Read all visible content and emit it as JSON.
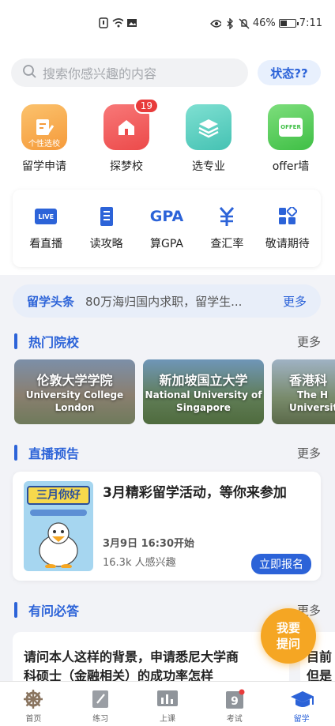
{
  "status_bar": {
    "battery": "46%",
    "battery_level": 0.46,
    "time": "7:11"
  },
  "search": {
    "placeholder": "搜索你感兴趣的内容"
  },
  "status_button": "状态??",
  "big_icons": [
    {
      "label": "留学申请",
      "tag": "个性选校",
      "color": "#f6a340"
    },
    {
      "label": "探梦校",
      "badge": "19",
      "color": "#f05a5a"
    },
    {
      "label": "选专业",
      "color": "#5ccfc0"
    },
    {
      "label": "offer墙",
      "tag": "OFFER",
      "color": "#58c95a"
    }
  ],
  "small_icons": [
    {
      "label": "看直播",
      "icon_text": "LIVE"
    },
    {
      "label": "读攻略"
    },
    {
      "label": "算GPA",
      "icon_text": "GPA"
    },
    {
      "label": "查汇率"
    },
    {
      "label": "敬请期待"
    }
  ],
  "news": {
    "tag": "留学头条",
    "text": "80万海归国内求职，留学生...",
    "more": "更多"
  },
  "sections": {
    "hot_schools": {
      "title": "热门院校",
      "more": "更多"
    },
    "live_preview": {
      "title": "直播预告",
      "more": "更多"
    },
    "qa": {
      "title": "有问必答",
      "more": "更多"
    }
  },
  "schools": [
    {
      "cn": "伦敦大学学院",
      "en1": "University College",
      "en2": "London"
    },
    {
      "cn": "新加坡国立大学",
      "en1": "National University of",
      "en2": "Singapore"
    },
    {
      "cn": "香港科",
      "en1": "The H",
      "en2": "Universit"
    }
  ],
  "live": {
    "poster_text": "三月你好",
    "title": "3月精彩留学活动，等你来参加",
    "time": "3月9日 16:30开始",
    "count": "16.3k 人感兴趣",
    "button": "立即报名"
  },
  "qa_cards": [
    {
      "line1": "请问本人这样的背景，申请悉尼大学商",
      "line2": "科硕士（金融相关）的成功率怎样"
    },
    {
      "line1": "目前",
      "line2": "但是"
    }
  ],
  "fab": {
    "line1": "我要",
    "line2": "提问"
  },
  "tabs": [
    {
      "label": "首页"
    },
    {
      "label": "练习"
    },
    {
      "label": "上课"
    },
    {
      "label": "考试"
    },
    {
      "label": "留学",
      "active": true
    }
  ]
}
